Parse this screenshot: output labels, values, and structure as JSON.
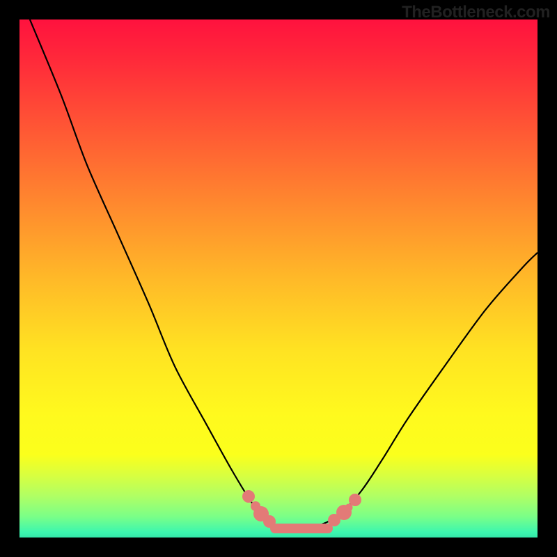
{
  "watermark": "TheBottleneck.com",
  "chart_data": {
    "type": "line",
    "title": "",
    "xlabel": "",
    "ylabel": "",
    "xlim": [
      0,
      100
    ],
    "ylim": [
      0,
      100
    ],
    "series": [
      {
        "name": "bottleneck-curve",
        "x": [
          2,
          8,
          13,
          19,
          25,
          30,
          36,
          41,
          45,
          48,
          51,
          54,
          58,
          62,
          66,
          70,
          75,
          82,
          90,
          97,
          100
        ],
        "values": [
          100,
          85.5,
          72,
          58.5,
          45,
          33,
          22,
          13,
          6.5,
          3.2,
          1.8,
          1.7,
          2.4,
          4.6,
          9.0,
          15,
          23,
          33,
          44,
          52,
          55
        ]
      }
    ],
    "markers": [
      {
        "x": 44.2,
        "y": 7.9,
        "size": "md"
      },
      {
        "x": 45.5,
        "y": 6.0,
        "size": "sm"
      },
      {
        "x": 46.6,
        "y": 4.6,
        "size": "lg"
      },
      {
        "x": 48.3,
        "y": 3.1,
        "size": "md"
      },
      {
        "x": 60.8,
        "y": 3.4,
        "size": "md"
      },
      {
        "x": 62.6,
        "y": 4.9,
        "size": "lg"
      },
      {
        "x": 63.6,
        "y": 5.8,
        "size": "xs"
      },
      {
        "x": 64.8,
        "y": 7.2,
        "size": "md"
      }
    ],
    "flat_segment": {
      "x_center": 54.5,
      "y": 1.75,
      "width_pct": 12.1
    }
  }
}
